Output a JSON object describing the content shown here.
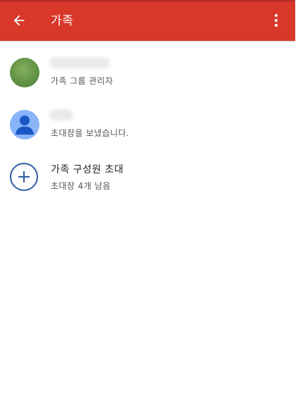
{
  "colors": {
    "toolbar": "#d8372a",
    "accent": "#2f5ca8"
  },
  "toolbar": {
    "title": "가족",
    "back_icon": "arrow-left-icon",
    "menu_icon": "more-vert-icon"
  },
  "members": [
    {
      "name": "",
      "role": "가족 그룹 관리자",
      "avatar_icon": "photo-avatar"
    },
    {
      "name": "",
      "role": "초대장을 보냈습니다.",
      "avatar_icon": "default-person-icon"
    }
  ],
  "invite": {
    "label": "가족 구성원 초대",
    "remaining": "초대장 4개 남음",
    "icon": "plus-circle-icon"
  }
}
